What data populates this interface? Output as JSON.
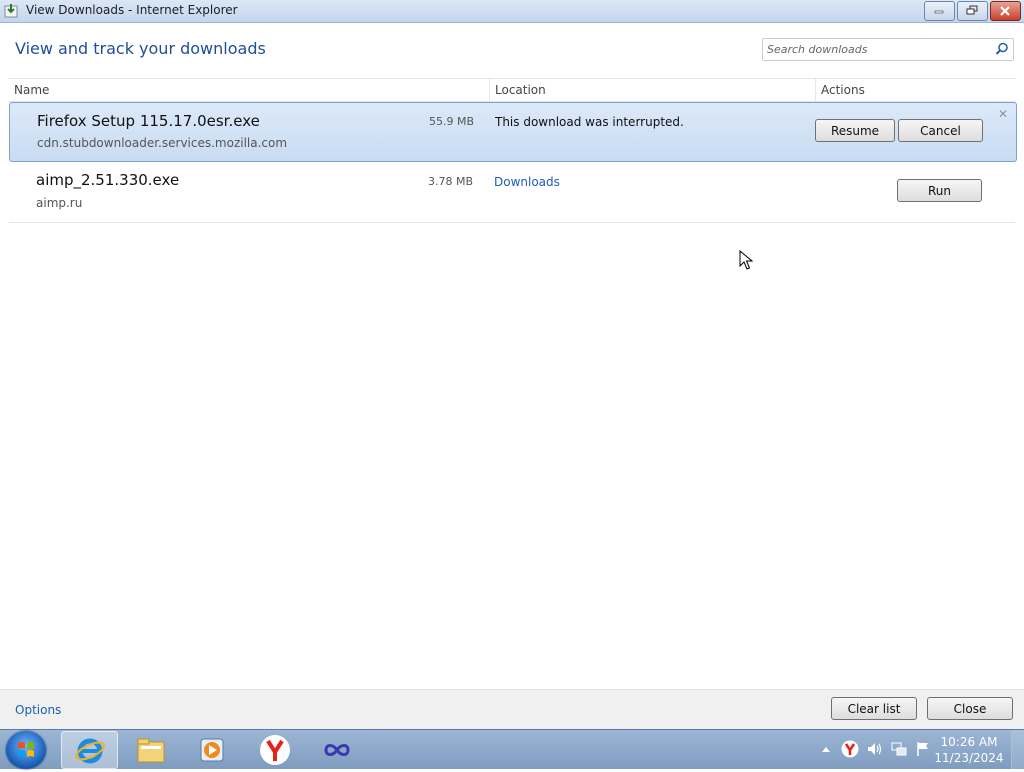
{
  "window": {
    "title": "View Downloads - Internet Explorer"
  },
  "header": {
    "title": "View and track your downloads",
    "search_placeholder": "Search downloads"
  },
  "columns": {
    "name": "Name",
    "location": "Location",
    "actions": "Actions"
  },
  "downloads": [
    {
      "filename": "Firefox Setup 115.17.0esr.exe",
      "source": "cdn.stubdownloader.services.mozilla.com",
      "size": "55.9 MB",
      "status": "This download was interrupted.",
      "actions": [
        "Resume",
        "Cancel"
      ],
      "selected": true
    },
    {
      "filename": "aimp_2.51.330.exe",
      "source": "aimp.ru",
      "size": "3.78 MB",
      "location_link": "Downloads",
      "actions": [
        "Run"
      ],
      "selected": false
    }
  ],
  "footer": {
    "options_label": "Options",
    "clear_list_label": "Clear list",
    "close_label": "Close"
  },
  "taskbar": {
    "items": [
      "internet-explorer",
      "file-explorer",
      "media-player",
      "yandex-browser",
      "infinity-app"
    ],
    "active_item": "internet-explorer",
    "tray_icons": [
      "show-hidden-icons",
      "yandex-icon",
      "volume-icon",
      "network-icon",
      "action-center-flag-icon"
    ],
    "time": "10:26 AM",
    "date": "11/23/2024"
  },
  "colors": {
    "accent_title": "#1f4e99",
    "link": "#1a5fb4",
    "selected_row": "#d4e4f7"
  }
}
